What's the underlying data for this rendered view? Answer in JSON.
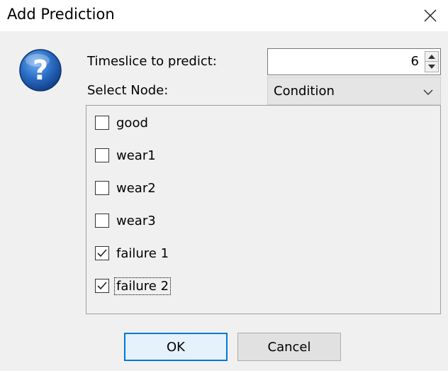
{
  "window": {
    "title": "Add Prediction",
    "close_icon": "close-icon"
  },
  "dialog": {
    "icon": "question-help-icon",
    "timeslice_label": "Timeslice to predict:",
    "timeslice_value": "6",
    "node_label": "Select Node:",
    "node_value": "Condition",
    "states": [
      {
        "label": "good",
        "checked": false
      },
      {
        "label": "wear1",
        "checked": false
      },
      {
        "label": "wear2",
        "checked": false
      },
      {
        "label": "wear3",
        "checked": false
      },
      {
        "label": "failure 1",
        "checked": true
      },
      {
        "label": "failure 2",
        "checked": true
      }
    ],
    "ok_label": "OK",
    "cancel_label": "Cancel"
  },
  "colors": {
    "accent": "#0078d7",
    "help_icon": "#1d5aa8"
  }
}
